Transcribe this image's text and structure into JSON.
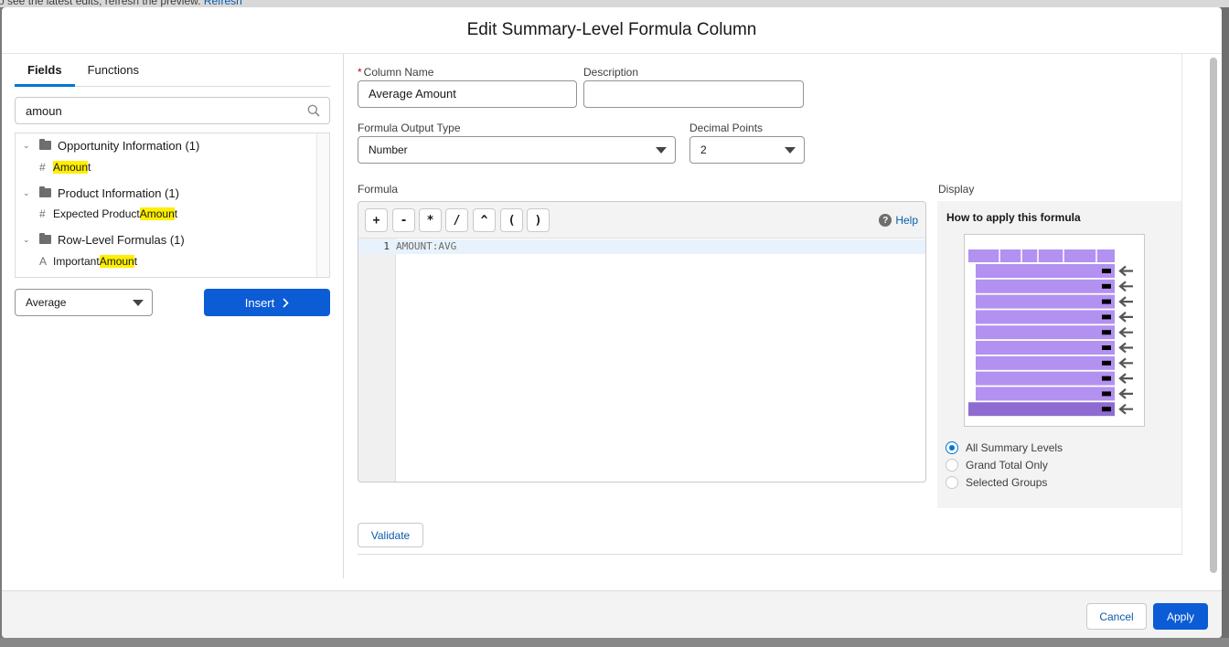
{
  "background": {
    "notice_text": "o see the latest edits, refresh the preview.",
    "refresh_link": "Refresh"
  },
  "modal": {
    "title": "Edit Summary-Level Formula Column"
  },
  "left": {
    "tabs": [
      {
        "label": "Fields",
        "active": true
      },
      {
        "label": "Functions",
        "active": false
      }
    ],
    "search": {
      "value": "amoun",
      "icon": "search-icon"
    },
    "groups": [
      {
        "label": "Opportunity Information (1)",
        "items": [
          {
            "type_icon": "#",
            "prefix": "",
            "match": "Amoun",
            "suffix": "t"
          }
        ]
      },
      {
        "label": "Product Information (1)",
        "items": [
          {
            "type_icon": "#",
            "prefix": "Expected Product ",
            "match": "Amoun",
            "suffix": "t"
          }
        ]
      },
      {
        "label": "Row-Level Formulas (1)",
        "items": [
          {
            "type_icon": "A",
            "prefix": "Important ",
            "match": "Amoun",
            "suffix": "t"
          }
        ]
      }
    ],
    "aggregate_select": "Average",
    "insert_label": "Insert"
  },
  "form": {
    "column_name_label": "Column Name",
    "column_name_value": "Average Amount",
    "description_label": "Description",
    "description_value": "",
    "output_type_label": "Formula Output Type",
    "output_type_value": "Number",
    "decimal_label": "Decimal Points",
    "decimal_value": "2"
  },
  "formula": {
    "label": "Formula",
    "operators": [
      "+",
      "-",
      "*",
      "/",
      "^",
      "(",
      ")"
    ],
    "help_label": "Help",
    "lines": [
      {
        "number": "1",
        "code": "AMOUNT:AVG"
      }
    ]
  },
  "display": {
    "label": "Display",
    "title": "How to apply this formula",
    "options": [
      {
        "label": "All Summary Levels",
        "checked": true
      },
      {
        "label": "Grand Total Only",
        "checked": false
      },
      {
        "label": "Selected Groups",
        "checked": false
      }
    ],
    "diagram_colors": {
      "light": "#b291f0",
      "dark": "#8d6bd0",
      "arrow": "#555555",
      "tick": "#000000"
    }
  },
  "validate_label": "Validate",
  "footer": {
    "cancel_label": "Cancel",
    "apply_label": "Apply"
  }
}
